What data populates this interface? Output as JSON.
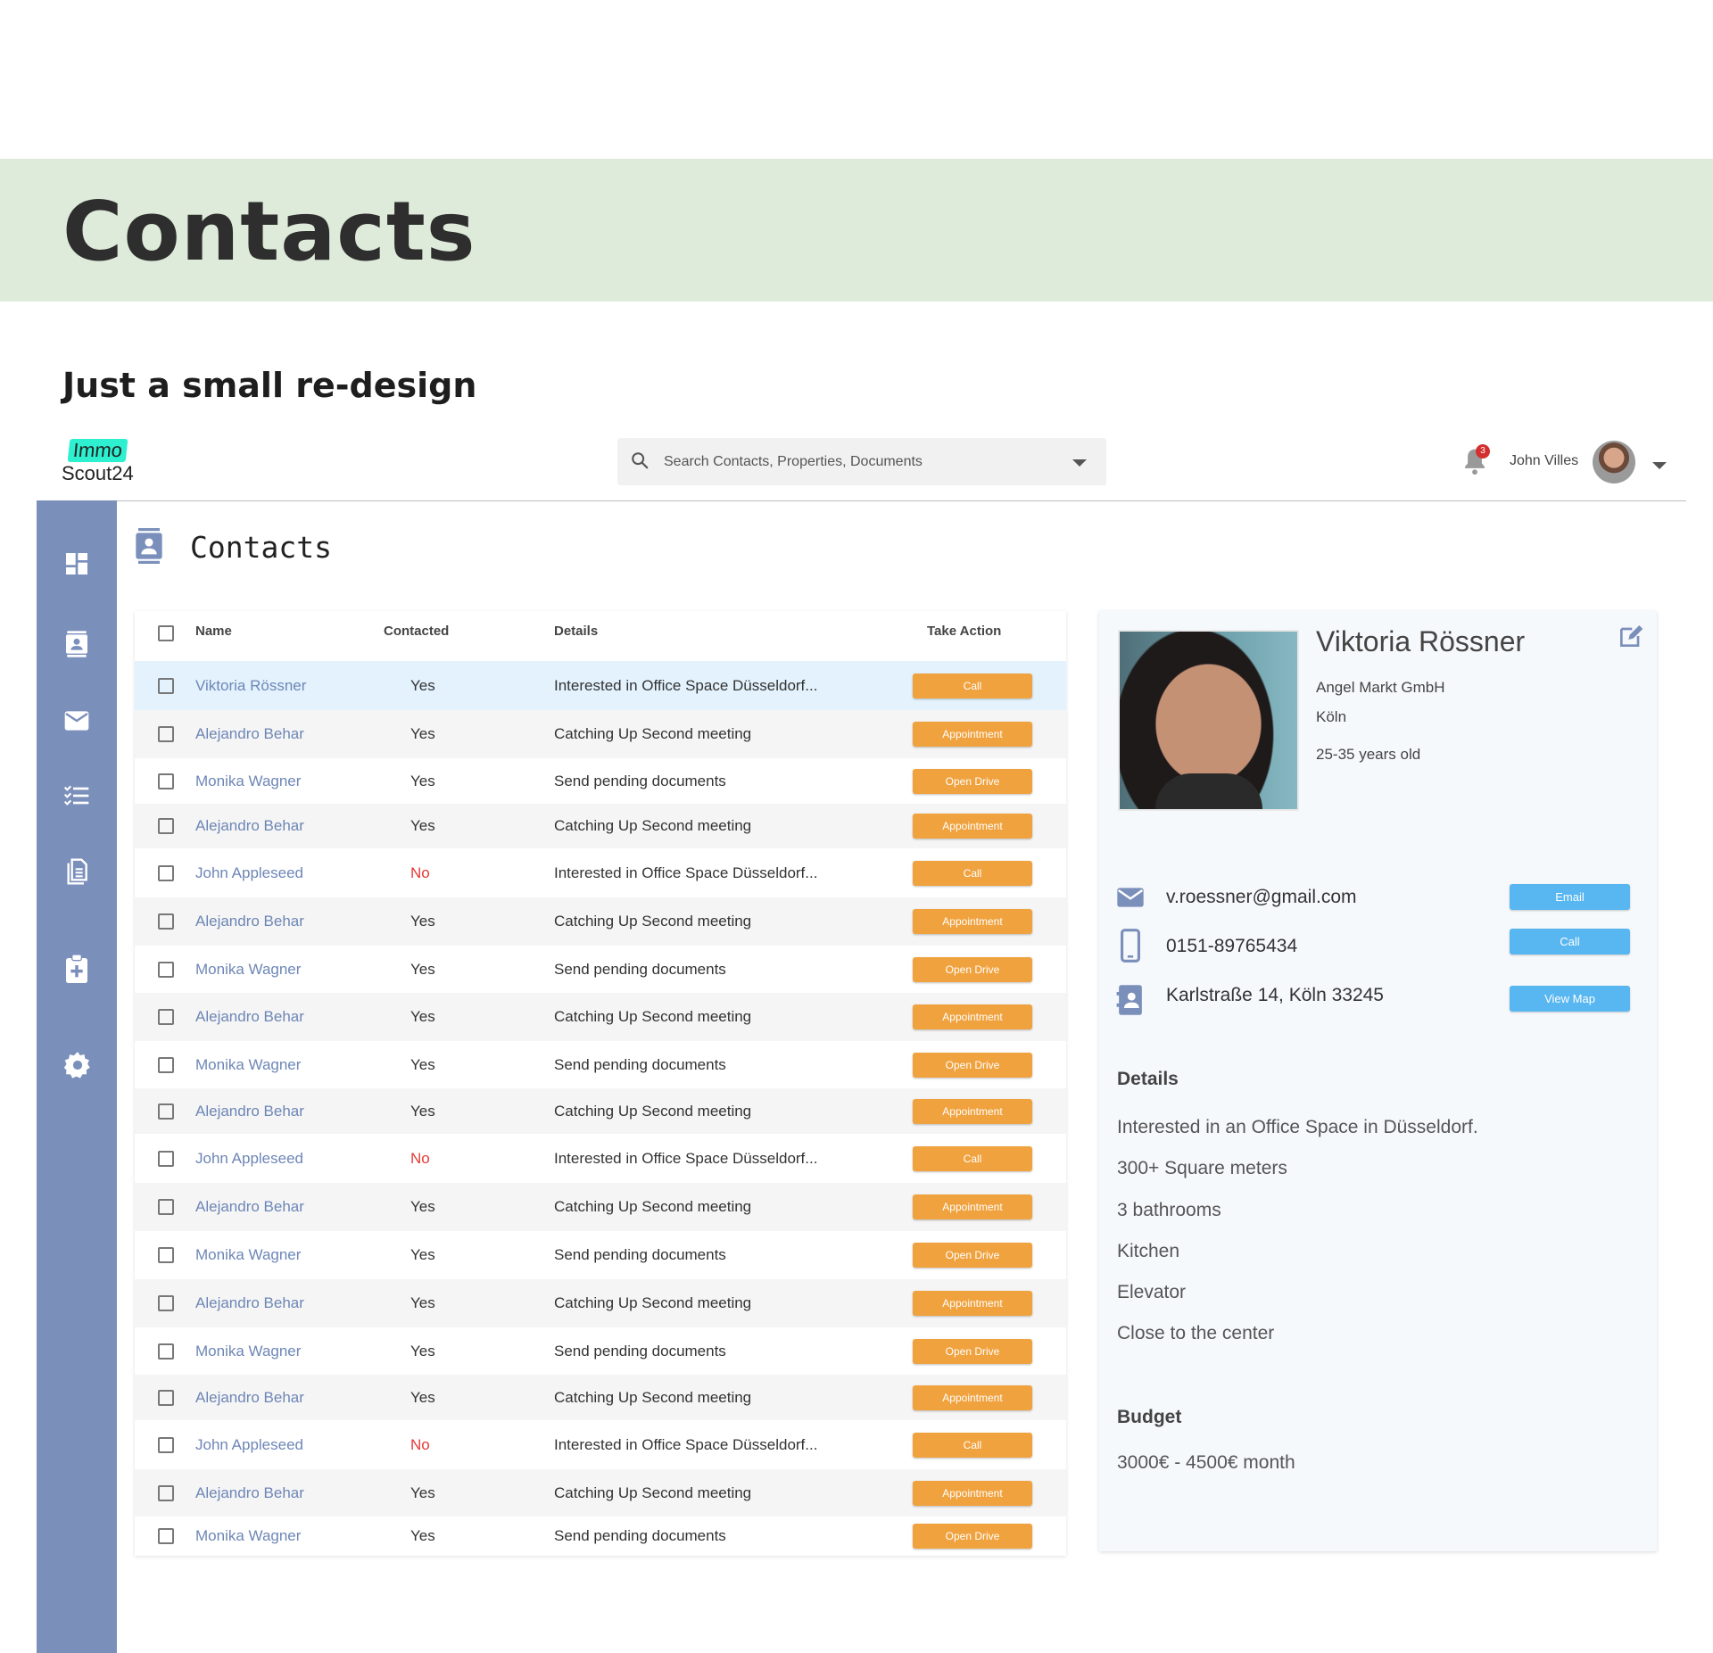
{
  "banner": {
    "title": "Contacts"
  },
  "subtitle": "Just a small re-design",
  "topbar": {
    "logo_line1": "Immo",
    "logo_line2": "Scout24",
    "search_placeholder": "Search Contacts, Properties, Documents",
    "notification_count": "3",
    "user_name": "John Villes"
  },
  "sidebar": {
    "items": [
      "dashboard-icon",
      "contacts-icon",
      "mail-icon",
      "checklist-icon",
      "document-icon",
      "clipboard-plus-icon",
      "settings-icon"
    ],
    "nav_color": "#7b8fbb"
  },
  "page": {
    "title": "Contacts"
  },
  "table": {
    "columns": [
      "Name",
      "Contacted",
      "Details",
      "Take Action"
    ],
    "rows": [
      {
        "name": "Viktoria Rössner",
        "contacted": "Yes",
        "details": "Interested in Office Space Düsseldorf...",
        "action": "Call",
        "selected": true
      },
      {
        "name": "Alejandro Behar",
        "contacted": "Yes",
        "details": "Catching Up Second meeting",
        "action": "Appointment"
      },
      {
        "name": "Monika Wagner",
        "contacted": "Yes",
        "details": "Send pending documents",
        "action": "Open Drive"
      },
      {
        "name": "Alejandro Behar",
        "contacted": "Yes",
        "details": "Catching Up Second meeting",
        "action": "Appointment"
      },
      {
        "name": "John Appleseed",
        "contacted": "No",
        "details": "Interested in Office Space Düsseldorf...",
        "action": "Call"
      },
      {
        "name": "Alejandro Behar",
        "contacted": "Yes",
        "details": "Catching Up Second meeting",
        "action": "Appointment"
      },
      {
        "name": "Monika Wagner",
        "contacted": "Yes",
        "details": "Send pending documents",
        "action": "Open Drive"
      },
      {
        "name": "Alejandro Behar",
        "contacted": "Yes",
        "details": "Catching Up Second meeting",
        "action": "Appointment"
      },
      {
        "name": "Monika Wagner",
        "contacted": "Yes",
        "details": "Send pending documents",
        "action": "Open Drive"
      },
      {
        "name": "Alejandro Behar",
        "contacted": "Yes",
        "details": "Catching Up Second meeting",
        "action": "Appointment"
      },
      {
        "name": "John Appleseed",
        "contacted": "No",
        "details": "Interested in Office Space Düsseldorf...",
        "action": "Call"
      },
      {
        "name": "Alejandro Behar",
        "contacted": "Yes",
        "details": "Catching Up Second meeting",
        "action": "Appointment"
      },
      {
        "name": "Monika Wagner",
        "contacted": "Yes",
        "details": "Send pending documents",
        "action": "Open Drive"
      },
      {
        "name": "Alejandro Behar",
        "contacted": "Yes",
        "details": "Catching Up Second meeting",
        "action": "Appointment"
      },
      {
        "name": "Monika Wagner",
        "contacted": "Yes",
        "details": "Send pending documents",
        "action": "Open Drive"
      },
      {
        "name": "Alejandro Behar",
        "contacted": "Yes",
        "details": "Catching Up Second meeting",
        "action": "Appointment"
      },
      {
        "name": "John Appleseed",
        "contacted": "No",
        "details": "Interested in Office Space Düsseldorf...",
        "action": "Call"
      },
      {
        "name": "Alejandro Behar",
        "contacted": "Yes",
        "details": "Catching Up Second meeting",
        "action": "Appointment"
      },
      {
        "name": "Monika Wagner",
        "contacted": "Yes",
        "details": "Send pending documents",
        "action": "Open Drive"
      }
    ]
  },
  "detail": {
    "name": "Viktoria Rössner",
    "company": "Angel Markt GmbH",
    "city": "Köln",
    "age": "25-35 years old",
    "email": "v.roessner@gmail.com",
    "phone": "0151-89765434",
    "address": "Karlstraße 14, Köln 33245",
    "email_button": "Email",
    "call_button": "Call",
    "map_button": "View Map",
    "details_heading": "Details",
    "details_lines": [
      "Interested in an Office Space in Düsseldorf.",
      "300+ Square meters",
      "3 bathrooms",
      "Kitchen",
      "Elevator",
      "Close to the center"
    ],
    "budget_heading": "Budget",
    "budget_value": "3000€ - 4500€ month"
  },
  "colors": {
    "banner_bg": "#deebda",
    "accent_orange": "#f0a23e",
    "accent_blue": "#58b6f0",
    "name_link": "#6d86b6",
    "status_no": "#e53935",
    "selected_row": "#e3f2fd"
  }
}
